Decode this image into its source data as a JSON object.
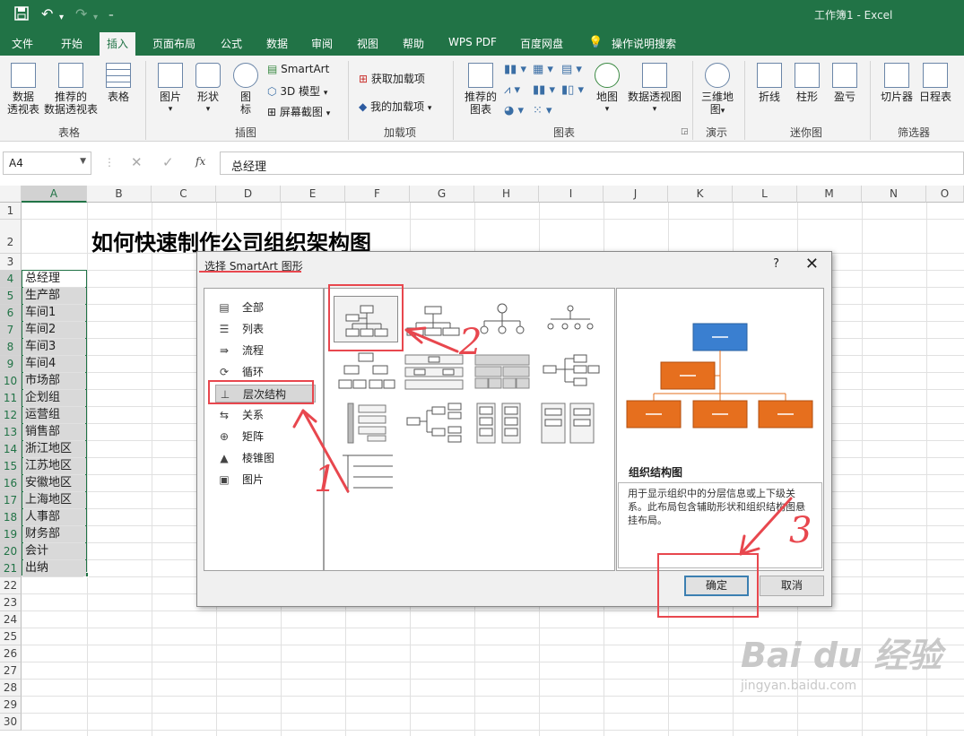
{
  "app": {
    "doc_title": "工作簿1  -  Excel",
    "quick_access": [
      "save-icon",
      "undo-icon",
      "redo-icon",
      "customize-icon"
    ]
  },
  "tabs": [
    "文件",
    "开始",
    "插入",
    "页面布局",
    "公式",
    "数据",
    "审阅",
    "视图",
    "帮助",
    "WPS PDF",
    "百度网盘",
    "操作说明搜索"
  ],
  "active_tab": "插入",
  "ribbon": {
    "groups": {
      "tables": "表格",
      "illustrations": "插图",
      "addins": "加载项",
      "charts": "图表",
      "tours": "演示",
      "sparklines": "迷你图",
      "filters": "筛选器"
    },
    "buttons": {
      "pivot": "数据\n透视表",
      "rec_pivot": "推荐的\n数据透视表",
      "table": "表格",
      "pictures": "图片",
      "shapes": "形状",
      "icons": "图\n标",
      "smartart": "SmartArt",
      "model3d": "3D 模型",
      "screenshot": "屏幕截图",
      "get_addins": "获取加载项",
      "my_addins": "我的加载项",
      "rec_charts": "推荐的\n图表",
      "map": "地图",
      "pivot_chart": "数据透视图",
      "map3d": "三维地\n图",
      "line": "折线",
      "column": "柱形",
      "winloss": "盈亏",
      "slicer": "切片器",
      "timeline": "日程表"
    }
  },
  "formula_bar": {
    "name_box": "A4",
    "formula": "总经理"
  },
  "columns": [
    "A",
    "B",
    "C",
    "D",
    "E",
    "F",
    "G",
    "H",
    "I",
    "J",
    "K",
    "L",
    "M",
    "N",
    "O"
  ],
  "rows": [
    "1",
    "2",
    "3",
    "4",
    "5",
    "6",
    "7",
    "8",
    "9",
    "10",
    "11",
    "12",
    "13",
    "14",
    "15",
    "16",
    "17",
    "18",
    "19",
    "20",
    "21",
    "22",
    "23",
    "24",
    "25",
    "26",
    "27",
    "28",
    "29",
    "30"
  ],
  "sheet_title": "如何快速制作公司组织架构图",
  "col_a": [
    "总经理",
    "生产部",
    "车间1",
    "车间2",
    "车间3",
    "车间4",
    "市场部",
    "企划组",
    "运营组",
    "销售部",
    "浙江地区",
    "江苏地区",
    "安徽地区",
    "上海地区",
    "人事部",
    "财务部",
    "会计",
    "出纳"
  ],
  "dialog": {
    "title": "选择 SmartArt 图形",
    "help": "?",
    "categories": [
      {
        "label": "全部",
        "icon": "all-icon"
      },
      {
        "label": "列表",
        "icon": "list-icon"
      },
      {
        "label": "流程",
        "icon": "process-icon"
      },
      {
        "label": "循环",
        "icon": "cycle-icon"
      },
      {
        "label": "层次结构",
        "icon": "hierarchy-icon"
      },
      {
        "label": "关系",
        "icon": "relationship-icon"
      },
      {
        "label": "矩阵",
        "icon": "matrix-icon"
      },
      {
        "label": "棱锥图",
        "icon": "pyramid-icon"
      },
      {
        "label": "图片",
        "icon": "picture-icon"
      }
    ],
    "selected_category": "层次结构",
    "preview_name": "组织结构图",
    "preview_desc": "用于显示组织中的分层信息或上下级关系。此布局包含辅助形状和组织结构图悬挂布局。",
    "ok": "确定",
    "cancel": "取消"
  },
  "annotations": [
    "1",
    "2",
    "3"
  ],
  "watermark": {
    "brand": "Bai du 经验",
    "url": "jingyan.baidu.com"
  },
  "colors": {
    "excel_green": "#217346",
    "annotation_red": "#e8474e",
    "preview_blue": "#3a7fd0",
    "preview_orange": "#e66f1e"
  }
}
